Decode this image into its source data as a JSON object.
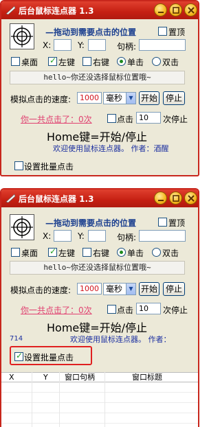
{
  "window": {
    "title": "后台鼠标连点器 1.3"
  },
  "picker": {
    "drag_label": "—拖动到需要点击的位置",
    "pin_label": "置顶",
    "x_label": "X:",
    "y_label": "Y:",
    "handle_label": "句柄:",
    "x_value": "",
    "y_value": "",
    "handle_value": ""
  },
  "options": {
    "desktop_label": "桌面",
    "left_label": "左键",
    "right_label": "右键",
    "single_label": "单击",
    "double_label": "双击"
  },
  "hint_text": "hello~你还没选择鼠标位置哦~",
  "speed": {
    "label": "模拟点击的速度:",
    "value": "1000",
    "unit": "毫秒",
    "start_label": "开始",
    "stop_label": "停止"
  },
  "counter": {
    "clicked_text": "你一共点击了：0次",
    "click_label": "点击",
    "stop_count": "10",
    "stop_label": "次停止"
  },
  "hotkey_text": "Home键=开始/停止",
  "welcome_text": "欢迎使用鼠标连点器。 作者：酒醒",
  "welcome_text_short": "欢迎使用鼠标连点器。 作者：",
  "batch_label": "设置批量点击",
  "status_number": "714",
  "table": {
    "headers": [
      "X",
      "Y",
      "窗口句柄",
      "窗口标题"
    ]
  }
}
